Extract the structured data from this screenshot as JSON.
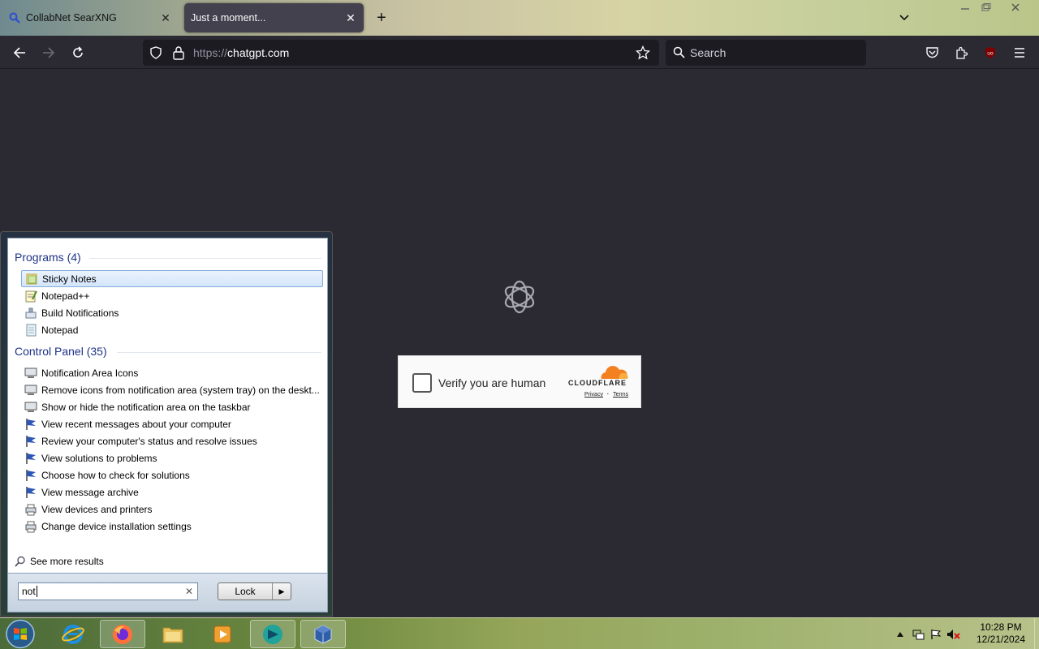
{
  "browser": {
    "tabs": [
      {
        "title": "CollabNet SearXNG",
        "active": false,
        "icon": "magnifier-icon"
      },
      {
        "title": "Just a moment...",
        "active": true,
        "icon": "loading-icon"
      }
    ],
    "url_scheme": "https://",
    "url_host": "chatgpt.com",
    "search_placeholder": "Search"
  },
  "page": {
    "logo": "openai-logo",
    "captcha": {
      "label": "Verify you are human",
      "brand": "CLOUDFLARE",
      "privacy": "Privacy",
      "separator": "·",
      "terms": "Terms"
    }
  },
  "start_menu": {
    "programs_header": "Programs (4)",
    "programs": [
      {
        "label": "Sticky Notes",
        "icon": "sticky-notes-icon",
        "selected": true
      },
      {
        "label": "Notepad++",
        "icon": "notepadpp-icon"
      },
      {
        "label": "Build Notifications",
        "icon": "build-icon"
      },
      {
        "label": "Notepad",
        "icon": "notepad-icon"
      }
    ],
    "control_panel_header": "Control Panel (35)",
    "control_panel": [
      {
        "label": "Notification Area Icons",
        "icon": "monitor-icon"
      },
      {
        "label": "Remove icons from notification area (system tray) on the deskt...",
        "icon": "monitor-icon"
      },
      {
        "label": "Show or hide the notification area on the taskbar",
        "icon": "monitor-icon"
      },
      {
        "label": "View recent messages about your computer",
        "icon": "flag-icon"
      },
      {
        "label": "Review your computer's status and resolve issues",
        "icon": "flag-icon"
      },
      {
        "label": "View solutions to problems",
        "icon": "flag-icon"
      },
      {
        "label": "Choose how to check for solutions",
        "icon": "flag-icon"
      },
      {
        "label": "View message archive",
        "icon": "flag-icon"
      },
      {
        "label": "View devices and printers",
        "icon": "printer-icon"
      },
      {
        "label": "Change device installation settings",
        "icon": "printer-icon"
      }
    ],
    "see_more": "See more results",
    "search_value": "not",
    "lock_label": "Lock"
  },
  "taskbar": {
    "apps": [
      "internet-explorer-icon",
      "firefox-icon",
      "file-explorer-icon",
      "media-player-icon",
      "app-icon",
      "virtualbox-icon"
    ],
    "time": "10:28 PM",
    "date": "12/21/2024"
  },
  "colors": {
    "browser_bg": "#2b2a33",
    "urlbar_bg": "#1c1b22",
    "start_header": "#1e3287",
    "cloudflare_orange": "#f48120"
  }
}
